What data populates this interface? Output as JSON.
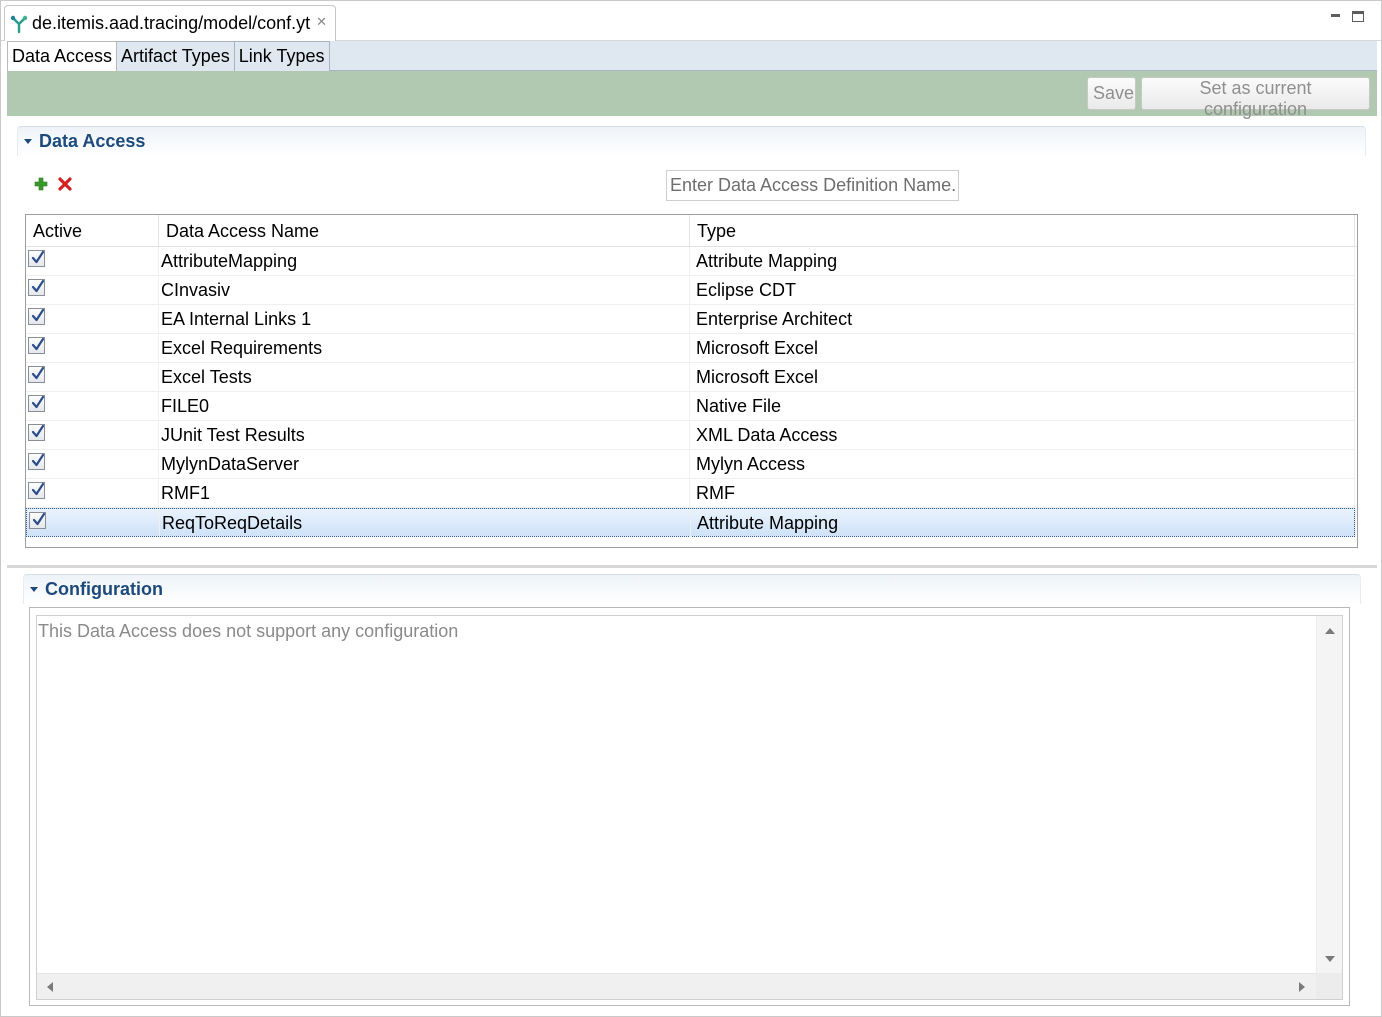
{
  "editor": {
    "tab_title": "de.itemis.aad.tracing/model/conf.yt",
    "tab_icon": "yakindu-tracing-icon"
  },
  "page_tabs": [
    {
      "label": "Data Access",
      "active": true
    },
    {
      "label": "Artifact Types",
      "active": false
    },
    {
      "label": "Link Types",
      "active": false
    }
  ],
  "toolbar": {
    "save_label": "Save",
    "set_current_label": "Set as current configuration",
    "band_color": "#b2c9b1"
  },
  "data_access_section": {
    "title": "Data Access",
    "search_placeholder": "Enter Data Access Definition Name...",
    "columns": [
      "Active",
      "Data Access Name",
      "Type"
    ],
    "rows": [
      {
        "active": true,
        "name": "AttributeMapping",
        "type": "Attribute Mapping",
        "selected": false
      },
      {
        "active": true,
        "name": "CInvasiv",
        "type": "Eclipse CDT",
        "selected": false
      },
      {
        "active": true,
        "name": "EA Internal Links 1",
        "type": "Enterprise Architect",
        "selected": false
      },
      {
        "active": true,
        "name": "Excel Requirements",
        "type": "Microsoft Excel",
        "selected": false
      },
      {
        "active": true,
        "name": "Excel Tests",
        "type": "Microsoft Excel",
        "selected": false
      },
      {
        "active": true,
        "name": "FILE0",
        "type": "Native File",
        "selected": false
      },
      {
        "active": true,
        "name": "JUnit Test Results",
        "type": "XML Data Access",
        "selected": false
      },
      {
        "active": true,
        "name": "MylynDataServer",
        "type": "Mylyn Access",
        "selected": false
      },
      {
        "active": true,
        "name": "RMF1",
        "type": "RMF",
        "selected": false
      },
      {
        "active": true,
        "name": "ReqToReqDetails",
        "type": "Attribute Mapping",
        "selected": true
      }
    ]
  },
  "configuration_section": {
    "title": "Configuration",
    "message": "This Data Access does not support any configuration"
  }
}
